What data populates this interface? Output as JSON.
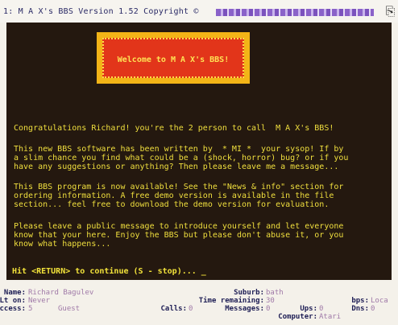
{
  "window": {
    "title": "1: M A X's BBS Version 1.52  Copyright ©",
    "close_glyph": "⎘"
  },
  "banner": {
    "text": "Welcome  to  M A X's BBS!"
  },
  "messages": [
    "Congratulations Richard! you're the 2 person to call  M A X's BBS!",
    "This new BBS software has been written by  * MI *  your sysop! If by\na slim chance you find what could be a (shock, horror) bug? or if you\nhave any suggestions or anything? Then please leave me a message...",
    "This BBS program is now available! See the \"News & info\" section for\nordering information. A free demo version is available in the file\nsection... feel free to download the demo version for evaluation.",
    "Please leave a public message to introduce yourself and let everyone\nknow that your here. Enjoy the BBS but please don't abuse it, or you\nknow what happens..."
  ],
  "prompt": "Hit <RETURN> to continue (S - stop)... _",
  "status": {
    "name_label": "Name:",
    "name_value": "Richard Bagulev",
    "lton_label": "Lt on:",
    "lton_value": "Never",
    "access_label": "Access:",
    "access_value": "5",
    "level_value": "Guest",
    "suburb_label": "Suburb:",
    "suburb_value": "bath",
    "time_label": "Time remaining:",
    "time_value": "30",
    "calls_label": "Calls:",
    "calls_value": "0",
    "messages_label": "Messages:",
    "messages_value": "0",
    "ups_label": "Ups:",
    "ups_value": "0",
    "dns_label": "Dns:",
    "dns_value": "0",
    "bps_label": "bps:",
    "bps_value": "Loca",
    "computer_label": "Computer:",
    "computer_value": "Atari"
  }
}
